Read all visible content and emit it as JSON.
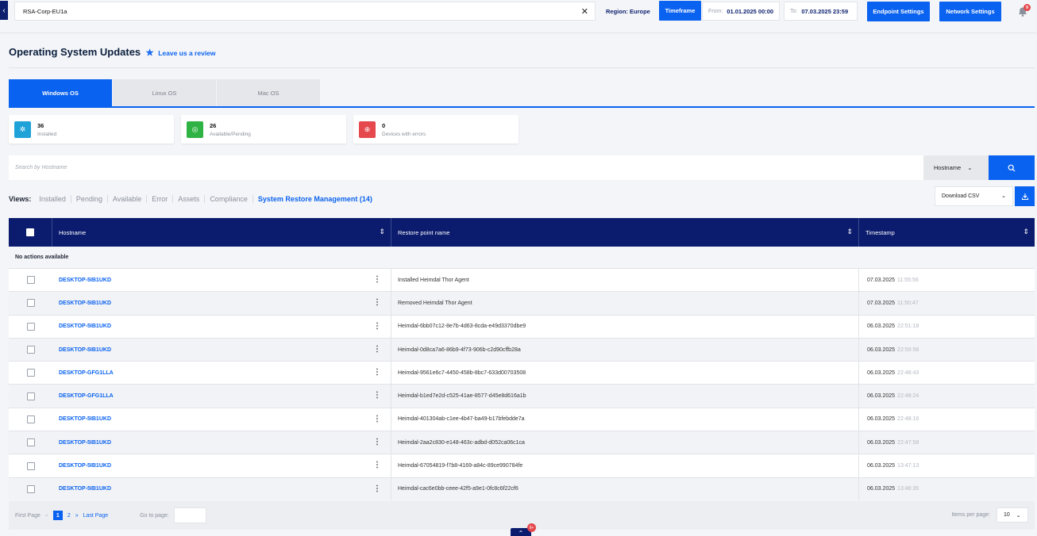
{
  "header": {
    "back_icon": "chevron-left-icon",
    "tenant": "RSA-Corp-EU1a",
    "region_label": "Region:",
    "region_value": "Europe",
    "timeframe_label": "Timeframe",
    "from_label": "From:",
    "from_value": "01.01.2025 00:00",
    "to_label": "To:",
    "to_value": "07.03.2025 23:59",
    "endpoint_settings": "Endpoint Settings",
    "network_settings": "Network Settings",
    "notif_count": "9"
  },
  "page": {
    "title": "Operating System Updates",
    "review_label": "Leave us a review"
  },
  "os_tabs": [
    {
      "label": "Windows OS",
      "active": true
    },
    {
      "label": "Linux OS",
      "active": false
    },
    {
      "label": "Mac OS",
      "active": false
    }
  ],
  "stats": [
    {
      "value": "36",
      "label": "Installed",
      "color": "#1fa2d8",
      "icon": "installed-icon"
    },
    {
      "value": "26",
      "label": "Available/Pending",
      "color": "#2fb344",
      "icon": "check-circle-icon"
    },
    {
      "value": "0",
      "label": "Devices with errors",
      "color": "#e5484d",
      "icon": "error-icon"
    }
  ],
  "search": {
    "placeholder": "Search by Hostname",
    "field": "Hostname"
  },
  "views": {
    "title": "Views:",
    "items": [
      "Installed",
      "Pending",
      "Available",
      "Error",
      "Assets",
      "Compliance",
      "System Restore Management (14)"
    ],
    "active_index": 6
  },
  "export": {
    "label": "Download CSV"
  },
  "table": {
    "columns": [
      "Hostname",
      "Restore point name",
      "Timestamp"
    ],
    "no_actions": "No actions available",
    "rows": [
      {
        "host": "DESKTOP-5IB1UKD",
        "name": "Installed Heimdal Thor Agent",
        "date": "07.03.2025",
        "time": "11:55:56"
      },
      {
        "host": "DESKTOP-5IB1UKD",
        "name": "Removed Heimdal Thor Agent",
        "date": "07.03.2025",
        "time": "11:50:47"
      },
      {
        "host": "DESKTOP-5IB1UKD",
        "name": "Heimdal-6bb07c12-8e7b-4d63-8cda-e49d3370dbe9",
        "date": "06.03.2025",
        "time": "22:51:18"
      },
      {
        "host": "DESKTOP-5IB1UKD",
        "name": "Heimdal-0d8ca7a6-86b9-4f73-906b-c2d90cffb28a",
        "date": "06.03.2025",
        "time": "22:50:58"
      },
      {
        "host": "DESKTOP-GFG1LLA",
        "name": "Heimdal-9561e6c7-4450-458b-8bc7-633d00703508",
        "date": "06.03.2025",
        "time": "22:48:43"
      },
      {
        "host": "DESKTOP-GFG1LLA",
        "name": "Heimdal-b1ed7e2d-c525-41ae-8577-d45e8d616a1b",
        "date": "06.03.2025",
        "time": "22:48:24"
      },
      {
        "host": "DESKTOP-5IB1UKD",
        "name": "Heimdal-401304ab-c1ee-4b47-ba49-b17bfebdde7a",
        "date": "06.03.2025",
        "time": "22:48:16"
      },
      {
        "host": "DESKTOP-5IB1UKD",
        "name": "Heimdal-2aa2c830-e148-463c-adbd-d052ca06c1ca",
        "date": "06.03.2025",
        "time": "22:47:58"
      },
      {
        "host": "DESKTOP-5IB1UKD",
        "name": "Heimdal-67054819-f7b8-4169-a84c-89ce990784fe",
        "date": "06.03.2025",
        "time": "13:47:13"
      },
      {
        "host": "DESKTOP-5IB1UKD",
        "name": "Heimdal-cac6e0bb-ceee-42f5-a9e1-0fc8c6f22cf6",
        "date": "06.03.2025",
        "time": "13:46:35"
      }
    ]
  },
  "pagination": {
    "first": "First Page",
    "pages": [
      "1",
      "2"
    ],
    "last": "Last Page",
    "goto": "Go to page:",
    "ipp_label": "Items per page:",
    "ipp_value": "10"
  },
  "scroll_badge": "9+"
}
